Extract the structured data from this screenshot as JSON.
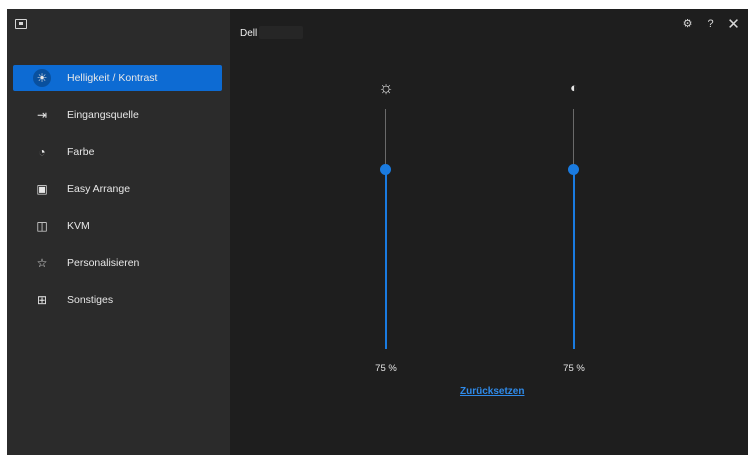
{
  "header": {
    "monitor_name": "Dell"
  },
  "sidebar": {
    "items": [
      {
        "label": "Helligkeit / Kontrast",
        "icon": "brightness-icon",
        "glyph": "☀",
        "active": true
      },
      {
        "label": "Eingangsquelle",
        "icon": "input-source-icon",
        "glyph": "⇥",
        "active": false
      },
      {
        "label": "Farbe",
        "icon": "palette-icon",
        "glyph": "◔",
        "active": false
      },
      {
        "label": "Easy Arrange",
        "icon": "easy-arrange-icon",
        "glyph": "▣",
        "active": false
      },
      {
        "label": "KVM",
        "icon": "kvm-icon",
        "glyph": "◫",
        "active": false
      },
      {
        "label": "Personalisieren",
        "icon": "star-icon",
        "glyph": "☆",
        "active": false
      },
      {
        "label": "Sonstiges",
        "icon": "others-icon",
        "glyph": "⊞",
        "active": false
      }
    ]
  },
  "controls": {
    "brightness": {
      "value": 0.75,
      "label": "75 %",
      "icon": "sun-icon",
      "glyph": "☼"
    },
    "contrast": {
      "value": 0.75,
      "label": "75 %",
      "icon": "contrast-icon",
      "glyph": "◐"
    },
    "reset_label": "Zurücksetzen"
  },
  "toolbar": {
    "settings_glyph": "⚙",
    "help_glyph": "?",
    "close_glyph": "✕"
  },
  "colors": {
    "accent": "#0d6bd3",
    "slider": "#1a7be0",
    "sidebar_bg": "#2b2b2b",
    "main_bg": "#1e1e1e"
  }
}
